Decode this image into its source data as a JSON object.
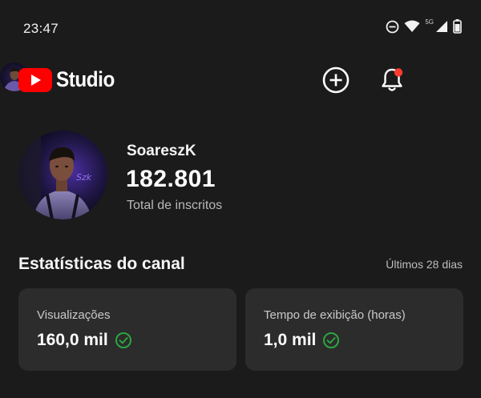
{
  "status_bar": {
    "time": "23:47",
    "network_label": "5G",
    "icons": [
      "do-not-disturb-icon",
      "wifi-icon",
      "signal-icon",
      "battery-icon"
    ]
  },
  "app_bar": {
    "logo_text": "Studio",
    "icons": [
      "create-icon",
      "bell-icon",
      "account-avatar"
    ],
    "notification_dot_color": "#ff3b30",
    "brand_color": "#ff0000"
  },
  "channel": {
    "name": "SoareszK",
    "subscribers": "182.801",
    "subscribers_label": "Total de inscritos"
  },
  "stats": {
    "title": "Estatísticas do canal",
    "period": "Últimos 28 dias",
    "cards": [
      {
        "label": "Visualizações",
        "value": "160,0 mil",
        "status_icon": "check-circle-icon"
      },
      {
        "label": "Tempo de exibição (horas)",
        "value": "1,0 mil",
        "status_icon": "check-circle-icon"
      }
    ],
    "check_color": "#2ba640"
  }
}
